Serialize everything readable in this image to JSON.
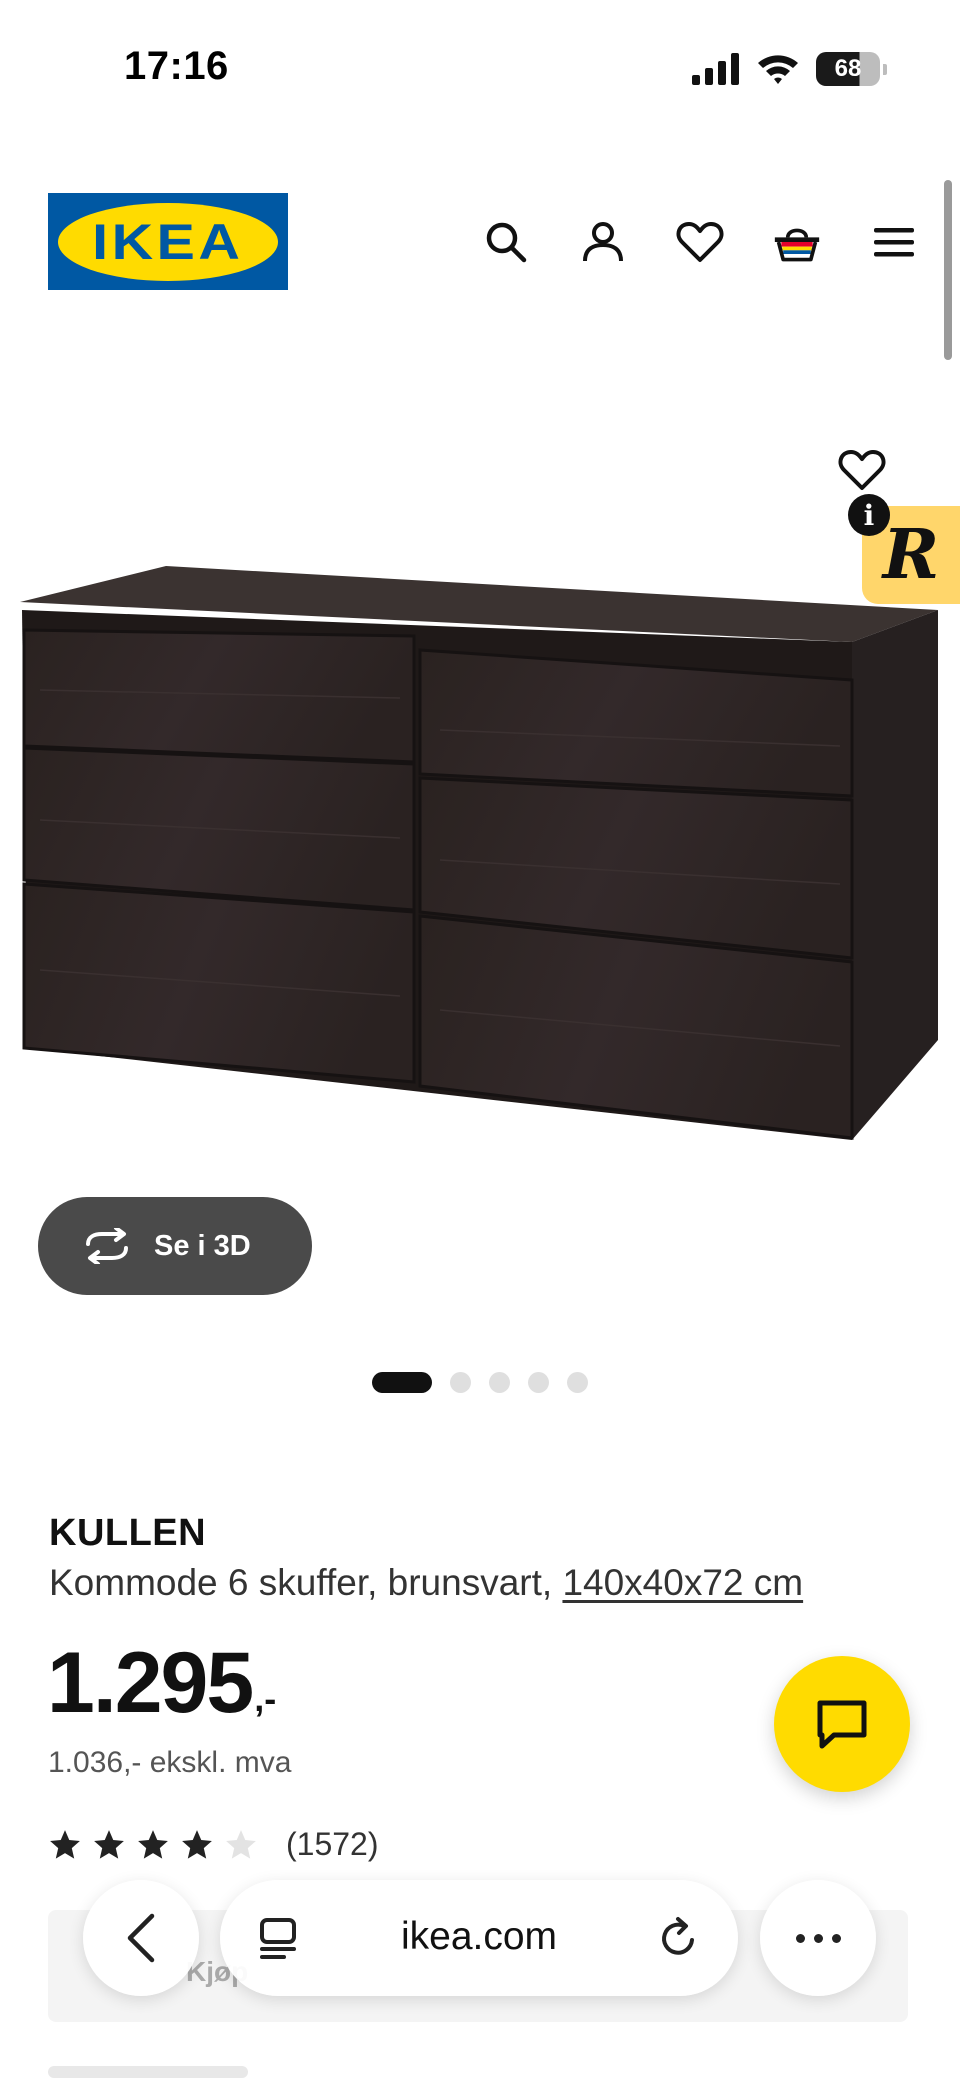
{
  "status_bar": {
    "time": "17:16",
    "battery": "68"
  },
  "header": {
    "logo_text": "IKEA",
    "icons": [
      "search-icon",
      "user-icon",
      "heart-icon",
      "basket-icon",
      "menu-icon"
    ]
  },
  "gallery": {
    "view_3d_label": "Se i 3D",
    "dots_total": 5,
    "active_dot": 1
  },
  "product": {
    "name": "KULLEN",
    "description": "Kommode 6 skuffer, brunsvart,",
    "measurements": "140x40x72 cm",
    "price": "1.295",
    "price_suffix": ",-",
    "price_ex_vat": "1.036,- ekskl. mva",
    "rating_value": 4,
    "rating_max": 5,
    "review_count": "(1572)"
  },
  "faded": {
    "buy_text": "Kjøp"
  },
  "browser": {
    "url": "ikea.com"
  },
  "colors": {
    "ikea_blue": "#0058a3",
    "ikea_yellow": "#ffdb00",
    "product_dark": "#2b2321"
  }
}
